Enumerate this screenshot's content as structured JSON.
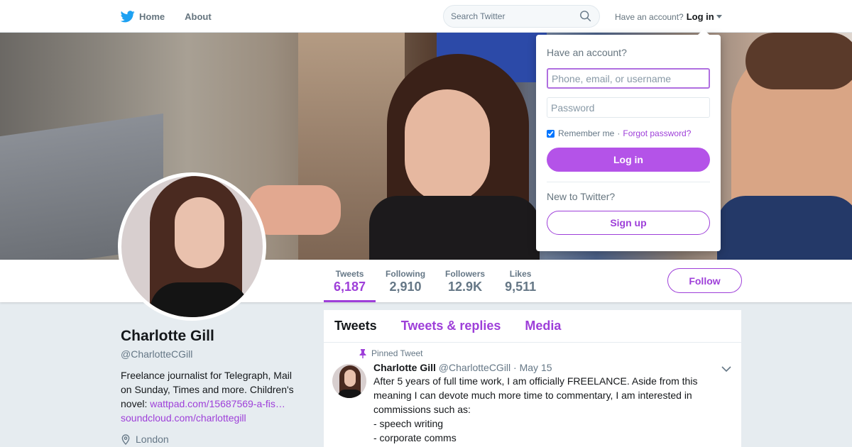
{
  "nav": {
    "logo_icon": "twitter-bird-icon",
    "home_label": "Home",
    "about_label": "About"
  },
  "search": {
    "placeholder": "Search Twitter",
    "icon": "search-icon"
  },
  "account": {
    "prompt": "Have an account?",
    "login_label": "Log in"
  },
  "login_dropdown": {
    "title": "Have an account?",
    "username_placeholder": "Phone, email, or username",
    "password_placeholder": "Password",
    "remember_label": "Remember me",
    "separator": "·",
    "forgot_label": "Forgot password?",
    "login_button": "Log in",
    "new_prompt": "New to Twitter?",
    "signup_button": "Sign up"
  },
  "profile": {
    "name": "Charlotte Gill",
    "handle": "@CharlotteCGill",
    "bio_text": "Freelance journalist for Telegraph, Mail on Sunday, Times and more. Children's novel: ",
    "bio_link1": "wattpad.com/15687569-a-fis…",
    "bio_link2": "soundcloud.com/charlottegill",
    "location": "London"
  },
  "stats": [
    {
      "label": "Tweets",
      "value": "6,187"
    },
    {
      "label": "Following",
      "value": "2,910"
    },
    {
      "label": "Followers",
      "value": "12.9K"
    },
    {
      "label": "Likes",
      "value": "9,511"
    }
  ],
  "follow_label": "Follow",
  "timeline": {
    "tabs": [
      "Tweets",
      "Tweets & replies",
      "Media"
    ],
    "tweet": {
      "pinned_label": "Pinned Tweet",
      "name": "Charlotte Gill",
      "handle": "@CharlotteCGill",
      "dot": "·",
      "date": "May 15",
      "lines": [
        "After 5 years of full time work, I am officially FREELANCE. Aside from this meaning I can devote much more time to commentary, I am interested in commissions such as:",
        "- speech writing",
        "- corporate comms"
      ]
    }
  },
  "colors": {
    "accent": "#9e3fd9",
    "login_button": "#b453e8",
    "twitter_blue": "#1da1f2"
  }
}
